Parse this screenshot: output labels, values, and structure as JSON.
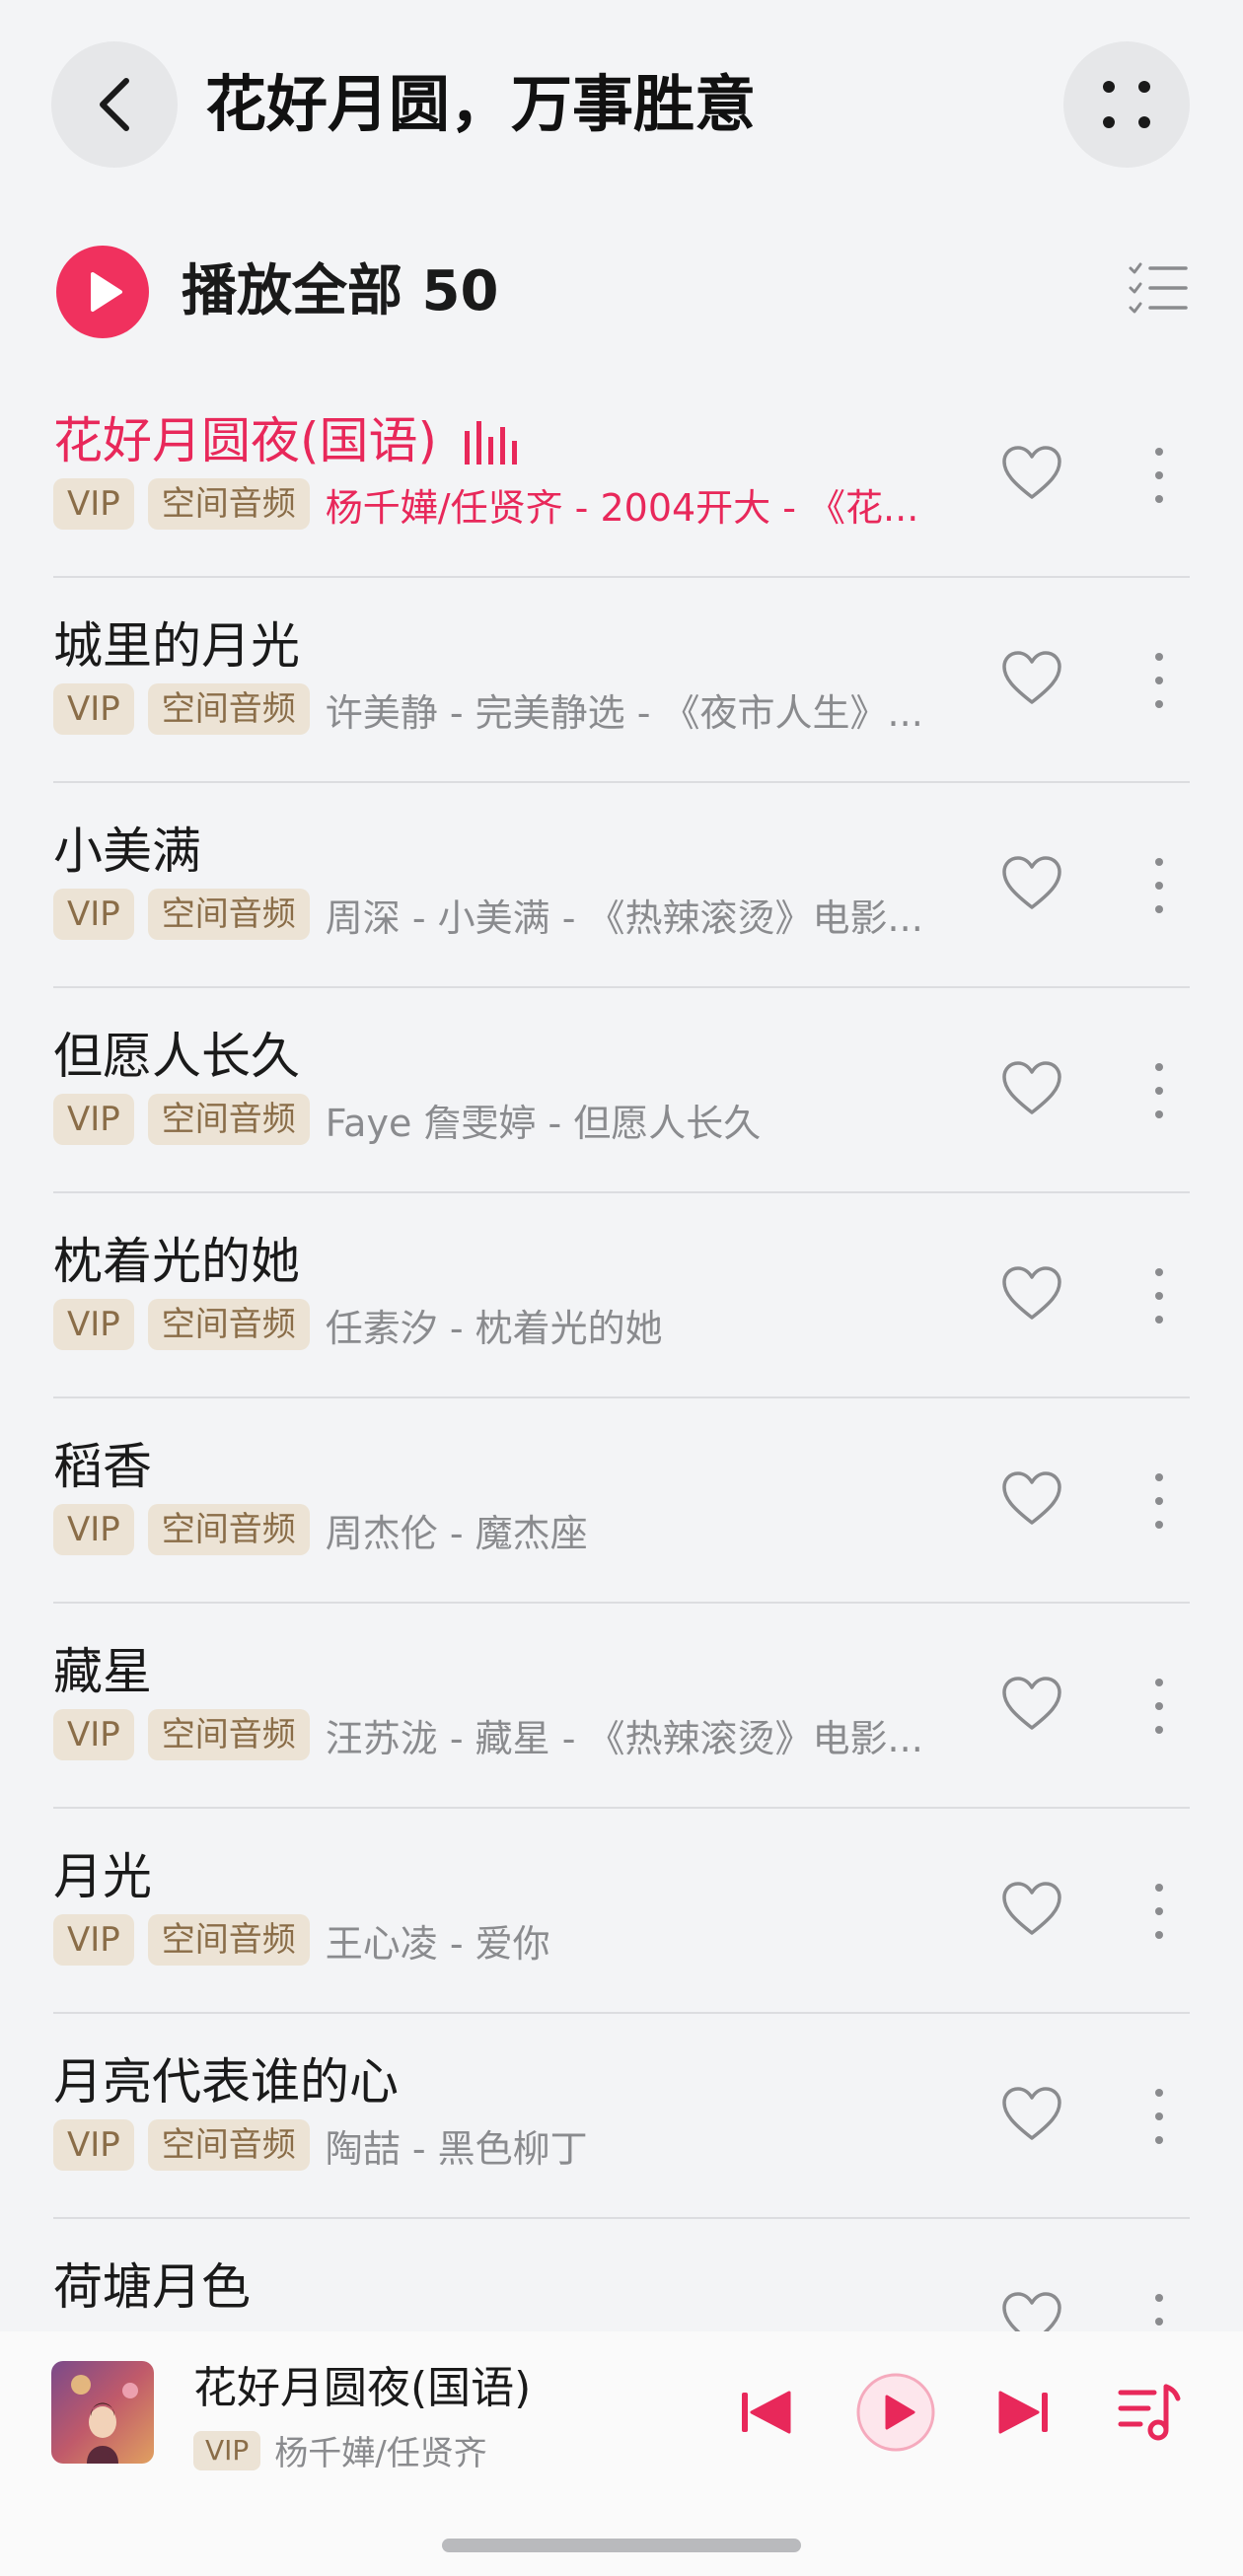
{
  "header": {
    "title": "花好月圆，万事胜意"
  },
  "play_all": {
    "label": "播放全部 50"
  },
  "colors": {
    "accent": "#e8285a",
    "tag_bg": "#ece3d5",
    "tag_text": "#8a6d48",
    "sub_text": "#8a8b8e"
  },
  "songs": [
    {
      "title": "花好月圆夜(国语)",
      "tags": [
        "VIP",
        "空间音频"
      ],
      "subtitle": "杨千嬅/任贤齐 - 2004开大 - 《花...",
      "playing": true
    },
    {
      "title": "城里的月光",
      "tags": [
        "VIP",
        "空间音频"
      ],
      "subtitle": "许美静 - 完美静选 - 《夜市人生》...",
      "playing": false
    },
    {
      "title": "小美满",
      "tags": [
        "VIP",
        "空间音频"
      ],
      "subtitle": "周深 - 小美满 - 《热辣滚烫》电影...",
      "playing": false
    },
    {
      "title": "但愿人长久",
      "tags": [
        "VIP",
        "空间音频"
      ],
      "subtitle": "Faye 詹雯婷 - 但愿人长久",
      "playing": false
    },
    {
      "title": "枕着光的她",
      "tags": [
        "VIP",
        "空间音频"
      ],
      "subtitle": "任素汐 - 枕着光的她",
      "playing": false
    },
    {
      "title": "稻香",
      "tags": [
        "VIP",
        "空间音频"
      ],
      "subtitle": "周杰伦 - 魔杰座",
      "playing": false
    },
    {
      "title": "藏星",
      "tags": [
        "VIP",
        "空间音频"
      ],
      "subtitle": "汪苏泷 - 藏星 - 《热辣滚烫》电影...",
      "playing": false
    },
    {
      "title": "月光",
      "tags": [
        "VIP",
        "空间音频"
      ],
      "subtitle": "王心凌 - 爱你",
      "playing": false
    },
    {
      "title": "月亮代表谁的心",
      "tags": [
        "VIP",
        "空间音频"
      ],
      "subtitle": "陶喆 - 黑色柳丁",
      "playing": false
    },
    {
      "title": "荷塘月色",
      "tags": [],
      "subtitle": "",
      "playing": false
    }
  ],
  "mini_player": {
    "title": "花好月圆夜(国语)",
    "tag": "VIP",
    "artist": "杨千嬅/任贤齐"
  }
}
